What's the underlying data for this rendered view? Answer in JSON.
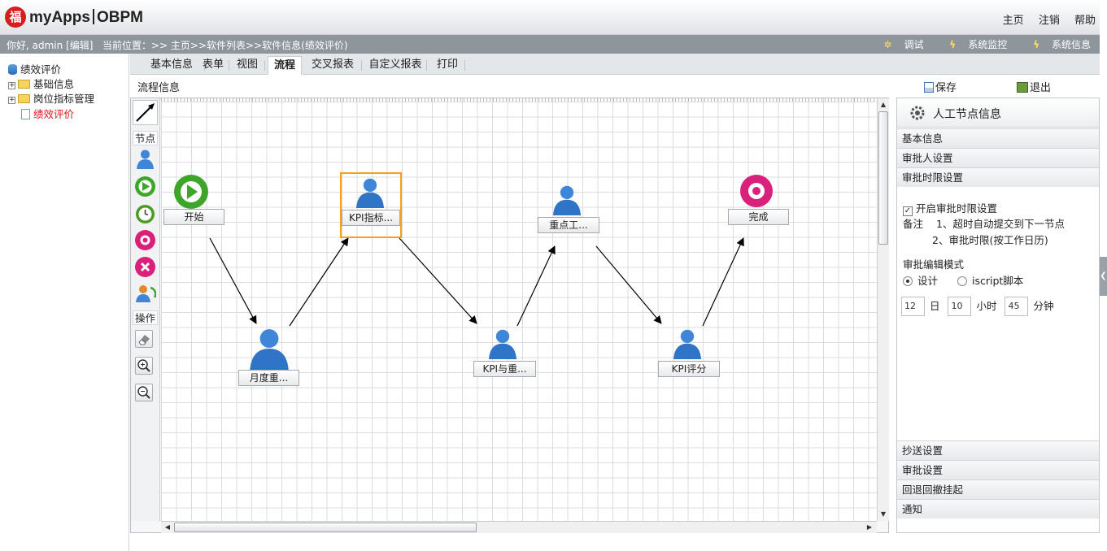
{
  "app": {
    "logo_text_left": "myApps",
    "logo_text_right": "OBPM",
    "logo_mark": "福"
  },
  "header": {
    "links": [
      "主页",
      "注销",
      "帮助"
    ]
  },
  "infobar": {
    "greeting": "你好, admin [编辑]",
    "location": "当前位置：>> 主页>>软件列表>>软件信息(绩效评价)",
    "tools": [
      "调试",
      "系统监控",
      "系统信息"
    ]
  },
  "tree": {
    "root": "绩效评价",
    "items": [
      {
        "label": "基础信息",
        "expandable": true
      },
      {
        "label": "岗位指标管理",
        "expandable": true
      },
      {
        "label": "绩效评价",
        "selected": true
      }
    ]
  },
  "tabs": [
    {
      "label": "基本信息"
    },
    {
      "label": "表单"
    },
    {
      "label": "视图"
    },
    {
      "label": "流程",
      "active": true
    },
    {
      "label": "交叉报表"
    },
    {
      "label": "自定义报表"
    },
    {
      "label": "打印"
    }
  ],
  "subbar": {
    "title": "流程信息",
    "save_label": "保存",
    "exit_label": "退出"
  },
  "palette": {
    "nodes_label": "节点",
    "ops_label": "操作",
    "node_icons": [
      "manual-node-icon",
      "start-node-icon",
      "timer-node-icon",
      "end-node-icon",
      "abort-node-icon",
      "auto-node-icon"
    ],
    "op_icons": [
      "eraser-icon",
      "zoom-in-icon",
      "zoom-out-icon"
    ]
  },
  "flow": {
    "nodes": [
      {
        "id": "start",
        "label": "开始",
        "type": "start"
      },
      {
        "id": "n1",
        "label": "月度重...",
        "type": "user"
      },
      {
        "id": "n2",
        "label": "KPI指标...",
        "type": "user",
        "selected": true
      },
      {
        "id": "n3",
        "label": "KPI与重...",
        "type": "user"
      },
      {
        "id": "n4",
        "label": "重点工...",
        "type": "user"
      },
      {
        "id": "n5",
        "label": "KPI评分",
        "type": "user"
      },
      {
        "id": "end",
        "label": "完成",
        "type": "end"
      }
    ]
  },
  "panel": {
    "title": "人工节点信息",
    "sections_top": [
      "基本信息",
      "审批人设置",
      "审批时限设置"
    ],
    "enable_label": "开启审批时限设置",
    "enable_checked": true,
    "note_label": "备注",
    "note_1": "1、超时自动提交到下一节点",
    "note_2": "2、审批时限(按工作日历)",
    "mode_label": "审批编辑模式",
    "mode_design": "设计",
    "mode_script": "iscript脚本",
    "days_value": "12",
    "days_unit": "日",
    "hours_value": "10",
    "hours_unit": "小时",
    "minutes_value": "45",
    "minutes_unit": "分钟",
    "sections_bottom": [
      "抄送设置",
      "审批设置",
      "回退回撤挂起",
      "通知"
    ]
  },
  "colors": {
    "accent_selection": "#f7a21a",
    "infobar_bg": "#8e959b",
    "tree_selected": "#e0151b"
  }
}
